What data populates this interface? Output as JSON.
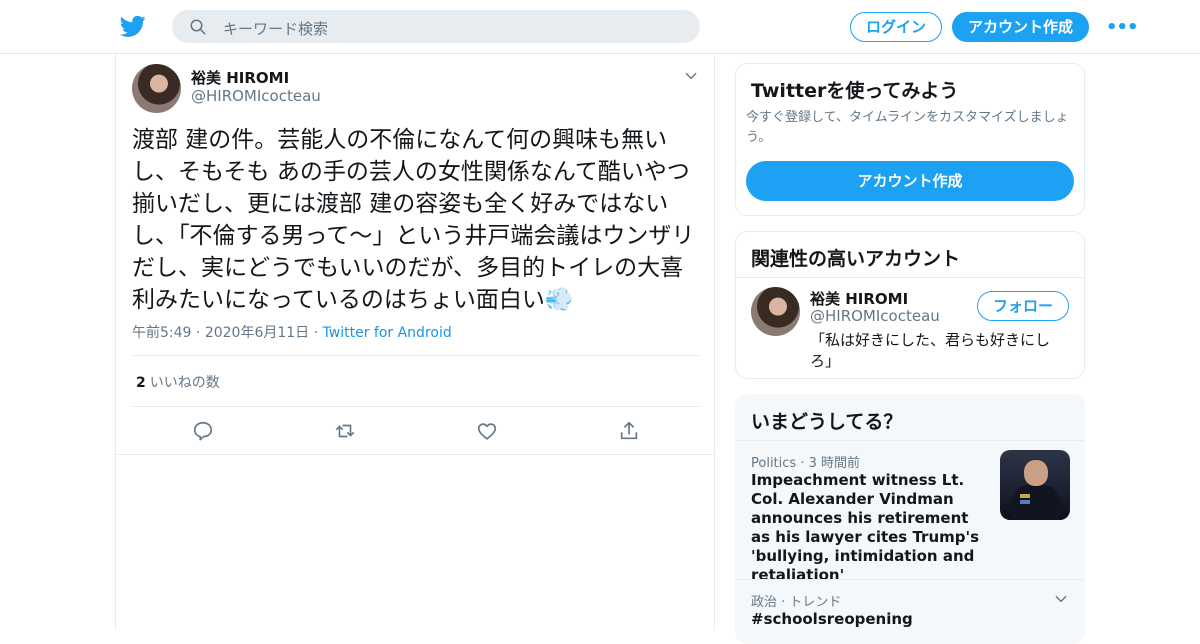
{
  "header": {
    "search_placeholder": "キーワード検索",
    "login_label": "ログイン",
    "signup_label": "アカウント作成",
    "more_label": "•••",
    "accent_color": "#1da1f2"
  },
  "tweet": {
    "author_name": "裕美 HIROMI",
    "author_handle": "@HIROMIcocteau",
    "text": "渡部 建の件。芸能人の不倫になんて何の興味も無いし、そもそも あの手の芸人の女性関係なんて酷いやつ揃いだし、更には渡部 建の容姿も全く好みではないし、「不倫する男って～」という井戸端会議はウンザリだし、実にどうでもいいのだが、多目的トイレの大喜利みたいになっているのはちょい面白い💨",
    "time": "午前5:49",
    "date": "2020年6月11日",
    "dot": "·",
    "source": "Twitter for Android",
    "likes_count": "2",
    "likes_label": "いいねの数"
  },
  "sidebar": {
    "signup_card": {
      "title": "Twitterを使ってみよう",
      "description": "今すぐ登録して、タイムラインをカスタマイズしましょう。",
      "button_label": "アカウント作成"
    },
    "relevant_card": {
      "title": "関連性の高いアカウント",
      "name": "裕美 HIROMI",
      "handle": "@HIROMIcocteau",
      "follow_label": "フォロー",
      "bio": "「私は好きにした、君らも好きにしろ」"
    },
    "trends_card": {
      "title": "いまどうしてる？",
      "item1_meta": "Politics · 3 時間前",
      "item1_headline": "Impeachment witness Lt. Col. Alexander Vindman announces his retirement as his lawyer cites Trump's 'bullying, intimidation and retaliation'",
      "item2_meta": "政治 · トレンド",
      "item2_tag": "#schoolsreopening"
    }
  }
}
